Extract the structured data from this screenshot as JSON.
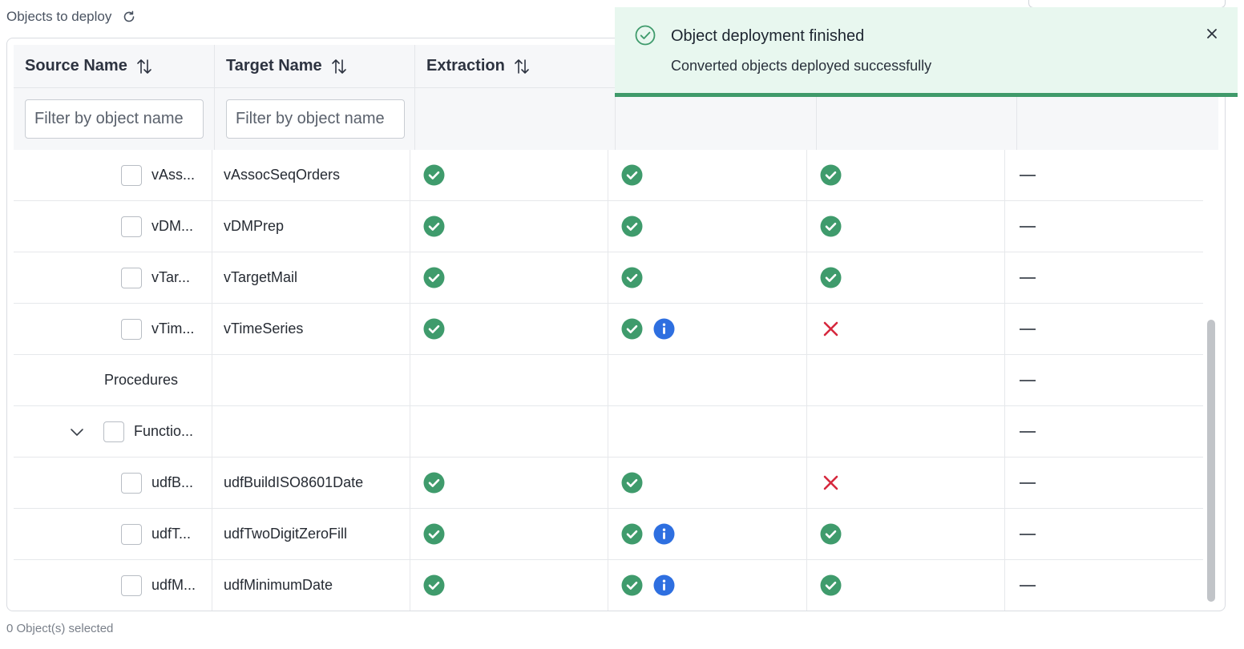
{
  "header": {
    "title": "Objects to deploy"
  },
  "table": {
    "columns": [
      {
        "label": "Source Name"
      },
      {
        "label": "Target Name"
      },
      {
        "label": "Extraction"
      }
    ],
    "filters": {
      "source_placeholder": "Filter by object name",
      "target_placeholder": "Filter by object name"
    },
    "rows": [
      {
        "source": "vAss...",
        "target": "vAssocSeqOrders"
      },
      {
        "source": "vDM...",
        "target": "vDMPrep"
      },
      {
        "source": "vTar...",
        "target": "vTargetMail"
      },
      {
        "source": "vTim...",
        "target": "vTimeSeries"
      },
      {
        "source": "Procedures",
        "target": ""
      },
      {
        "source": "Functio...",
        "target": ""
      },
      {
        "source": "udfB...",
        "target": "udfBuildISO8601Date"
      },
      {
        "source": "udfT...",
        "target": "udfTwoDigitZeroFill"
      },
      {
        "source": "udfM...",
        "target": "udfMinimumDate"
      }
    ],
    "row_status": [
      {
        "extraction": "success",
        "col4": [
          "success"
        ],
        "col5": "success"
      },
      {
        "extraction": "success",
        "col4": [
          "success"
        ],
        "col5": "success"
      },
      {
        "extraction": "success",
        "col4": [
          "success"
        ],
        "col5": "success"
      },
      {
        "extraction": "success",
        "col4": [
          "success",
          "info"
        ],
        "col5": "error"
      },
      {
        "extraction": "",
        "col4": [],
        "col5": ""
      },
      {
        "extraction": "",
        "col4": [],
        "col5": ""
      },
      {
        "extraction": "success",
        "col4": [
          "success"
        ],
        "col5": "error"
      },
      {
        "extraction": "success",
        "col4": [
          "success",
          "info"
        ],
        "col5": "success"
      },
      {
        "extraction": "success",
        "col4": [
          "success",
          "info"
        ],
        "col5": "success"
      }
    ]
  },
  "footer": {
    "selection": "0 Object(s) selected"
  },
  "toast": {
    "title": "Object deployment finished",
    "message": "Converted objects deployed successfully"
  },
  "colors": {
    "success": "#3f9b6c",
    "error": "#d6283d",
    "info": "#2e6fe0",
    "toast_bg": "#e8f7ef",
    "toast_border": "#3f9a6a"
  },
  "icons": {
    "success": "check-circle-icon",
    "error": "x-icon",
    "info": "info-icon",
    "sort": "sort-arrows-icon",
    "refresh": "refresh-icon",
    "close": "close-icon",
    "chevron": "chevron-down-icon"
  }
}
